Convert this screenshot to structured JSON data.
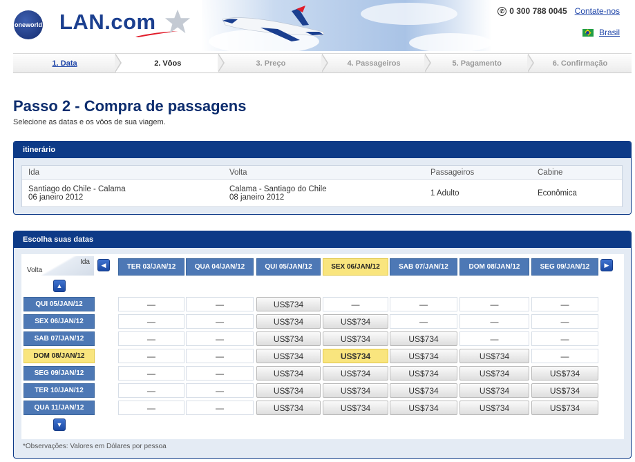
{
  "header": {
    "oneworld_logo": "oneworld",
    "brand_logo": "LAN.com",
    "phone_icon": "phone-icon",
    "phone": "0 300 788 0045",
    "contact_link": "Contate-nos",
    "country": "Brasil",
    "flag_icon": "brazil-flag-icon"
  },
  "steps": [
    {
      "label": "1. Data",
      "state": "done"
    },
    {
      "label": "2. Vôos",
      "state": "current"
    },
    {
      "label": "3. Preço",
      "state": "pending"
    },
    {
      "label": "4. Passageiros",
      "state": "pending"
    },
    {
      "label": "5. Pagamento",
      "state": "pending"
    },
    {
      "label": "6. Confirmação",
      "state": "pending"
    }
  ],
  "page": {
    "title": "Passo 2 - Compra de passagens",
    "subtitle": "Selecione as datas e os vôos de sua viagem."
  },
  "itinerary": {
    "heading": "itinerário",
    "headers": [
      "Ida",
      "Volta",
      "Passageiros",
      "Cabine"
    ],
    "ida_route": "Santiago do Chile - Calama",
    "ida_date": "06 janeiro 2012",
    "volta_route": "Calama - Santiago do Chile",
    "volta_date": "08 janeiro 2012",
    "passengers": "1 Adulto",
    "cabin": "Econômica"
  },
  "dates": {
    "heading": "Escolha suas datas",
    "corner_ida": "Ida",
    "corner_volta": "Volta",
    "columns": [
      "TER 03/JAN/12",
      "QUA 04/JAN/12",
      "QUI 05/JAN/12",
      "SEX 06/JAN/12",
      "SAB 07/JAN/12",
      "DOM 08/JAN/12",
      "SEG 09/JAN/12"
    ],
    "selected_column": 3,
    "rows": [
      {
        "label": "QUI 05/JAN/12",
        "cells": [
          "—",
          "—",
          "US$734",
          "—",
          "—",
          "—",
          "—"
        ]
      },
      {
        "label": "SEX 06/JAN/12",
        "cells": [
          "—",
          "—",
          "US$734",
          "US$734",
          "—",
          "—",
          "—"
        ]
      },
      {
        "label": "SAB 07/JAN/12",
        "cells": [
          "—",
          "—",
          "US$734",
          "US$734",
          "US$734",
          "—",
          "—"
        ]
      },
      {
        "label": "DOM 08/JAN/12",
        "cells": [
          "—",
          "—",
          "US$734",
          "US$734",
          "US$734",
          "US$734",
          "—"
        ]
      },
      {
        "label": "SEG 09/JAN/12",
        "cells": [
          "—",
          "—",
          "US$734",
          "US$734",
          "US$734",
          "US$734",
          "US$734"
        ]
      },
      {
        "label": "TER 10/JAN/12",
        "cells": [
          "—",
          "—",
          "US$734",
          "US$734",
          "US$734",
          "US$734",
          "US$734"
        ]
      },
      {
        "label": "QUA 11/JAN/12",
        "cells": [
          "—",
          "—",
          "US$734",
          "US$734",
          "US$734",
          "US$734",
          "US$734"
        ]
      }
    ],
    "selected_row": 3,
    "note": "*Observações: Valores em Dólares por pessoa"
  }
}
